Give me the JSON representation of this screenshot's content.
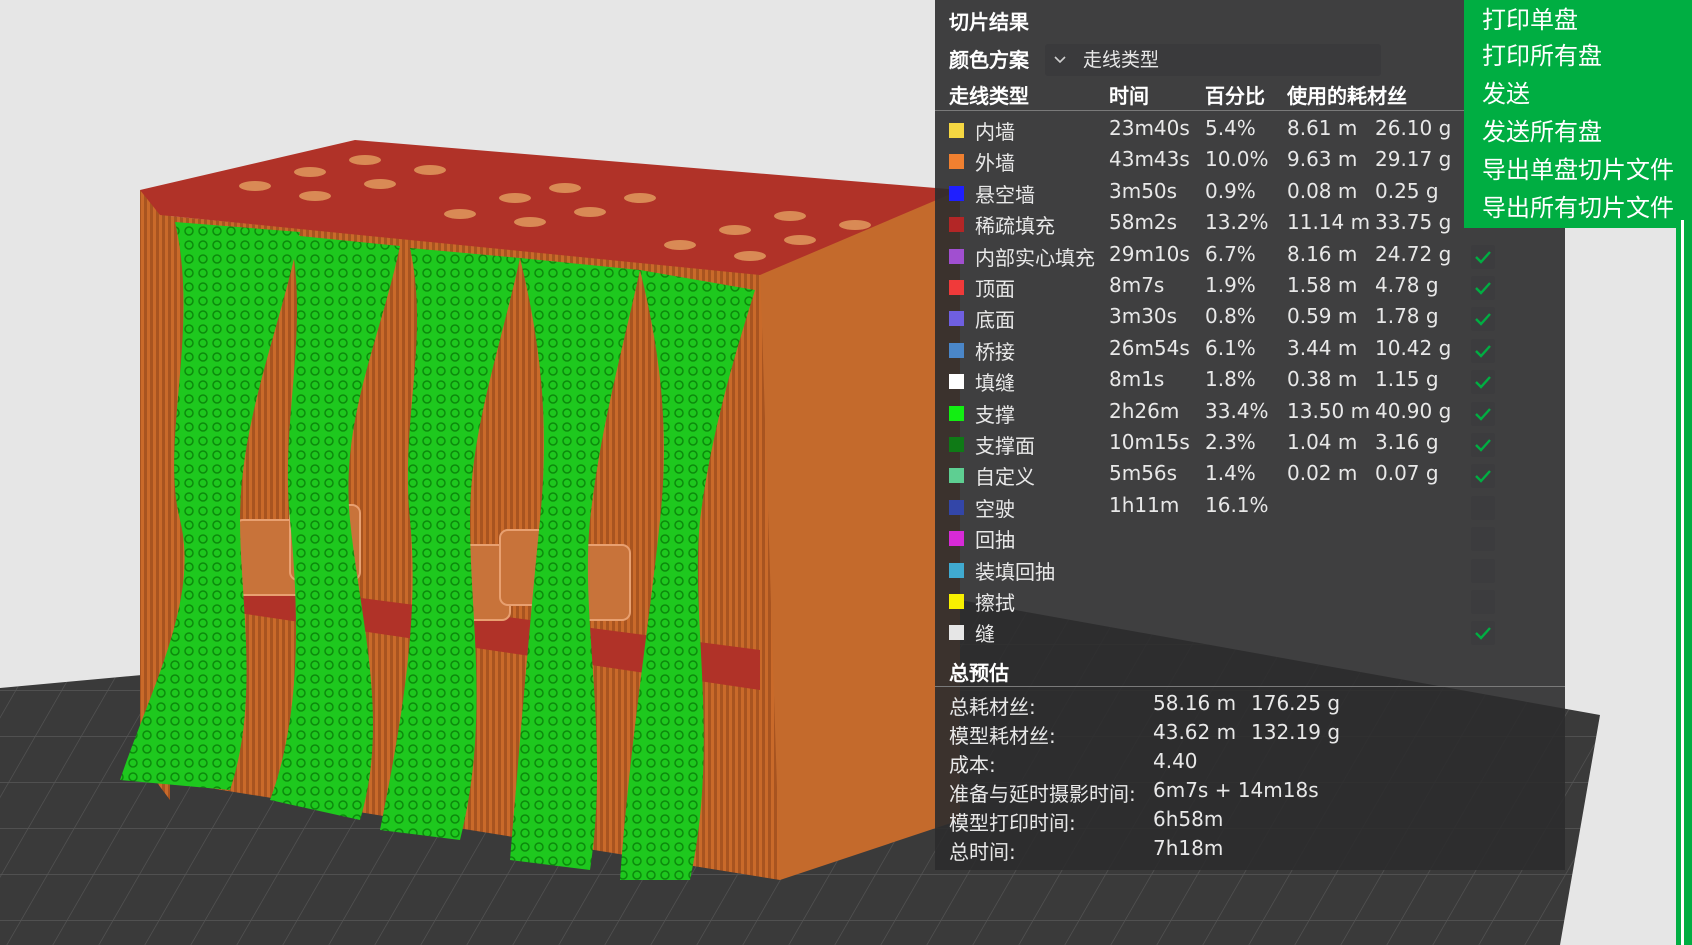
{
  "panel": {
    "title": "切片结果",
    "color_scheme_label": "颜色方案",
    "color_scheme_value": "走线类型",
    "columns": [
      "走线类型",
      "时间",
      "百分比",
      "使用的耗材丝"
    ],
    "rows": [
      {
        "name": "内墙",
        "color": "#f5d742",
        "time": "23m40s",
        "percent": "5.4%",
        "length": "8.61 m",
        "weight": "26.10 g",
        "visible": true
      },
      {
        "name": "外墙",
        "color": "#f08030",
        "time": "43m43s",
        "percent": "10.0%",
        "length": "9.63 m",
        "weight": "29.17 g",
        "visible": true
      },
      {
        "name": "悬空墙",
        "color": "#1f1fff",
        "time": "3m50s",
        "percent": "0.9%",
        "length": "0.08 m",
        "weight": "0.25 g",
        "visible": true
      },
      {
        "name": "稀疏填充",
        "color": "#b32626",
        "time": "58m2s",
        "percent": "13.2%",
        "length": "11.14 m",
        "weight": "33.75 g",
        "visible": true
      },
      {
        "name": "内部实心填充",
        "color": "#a14fd0",
        "time": "29m10s",
        "percent": "6.7%",
        "length": "8.16 m",
        "weight": "24.72 g",
        "visible": true
      },
      {
        "name": "顶面",
        "color": "#f03a3a",
        "time": "8m7s",
        "percent": "1.9%",
        "length": "1.58 m",
        "weight": "4.78 g",
        "visible": true
      },
      {
        "name": "底面",
        "color": "#6f5fe0",
        "time": "3m30s",
        "percent": "0.8%",
        "length": "0.59 m",
        "weight": "1.78 g",
        "visible": true
      },
      {
        "name": "桥接",
        "color": "#4a86c8",
        "time": "26m54s",
        "percent": "6.1%",
        "length": "3.44 m",
        "weight": "10.42 g",
        "visible": true
      },
      {
        "name": "填缝",
        "color": "#ffffff",
        "time": "8m1s",
        "percent": "1.8%",
        "length": "0.38 m",
        "weight": "1.15 g",
        "visible": true
      },
      {
        "name": "支撑",
        "color": "#12ee12",
        "time": "2h26m",
        "percent": "33.4%",
        "length": "13.50 m",
        "weight": "40.90 g",
        "visible": true
      },
      {
        "name": "支撑面",
        "color": "#0f7a16",
        "time": "10m15s",
        "percent": "2.3%",
        "length": "1.04 m",
        "weight": "3.16 g",
        "visible": true
      },
      {
        "name": "自定义",
        "color": "#5ecf92",
        "time": "5m56s",
        "percent": "1.4%",
        "length": "0.02 m",
        "weight": "0.07 g",
        "visible": true
      },
      {
        "name": "空驶",
        "color": "#3346a8",
        "time": "1h11m",
        "percent": "16.1%",
        "length": "",
        "weight": "",
        "visible": false
      },
      {
        "name": "回抽",
        "color": "#d72ad7",
        "time": "",
        "percent": "",
        "length": "",
        "weight": "",
        "visible": false
      },
      {
        "name": "装填回抽",
        "color": "#40aad0",
        "time": "",
        "percent": "",
        "length": "",
        "weight": "",
        "visible": false
      },
      {
        "name": "擦拭",
        "color": "#f8f000",
        "time": "",
        "percent": "",
        "length": "",
        "weight": "",
        "visible": false
      },
      {
        "name": "缝",
        "color": "#e6e6e6",
        "time": "",
        "percent": "",
        "length": "",
        "weight": "",
        "visible": true
      }
    ],
    "summary_title": "总预估",
    "summary": [
      {
        "label": "总耗材丝:",
        "value": "58.16 m",
        "value2": "176.25 g"
      },
      {
        "label": "模型耗材丝:",
        "value": "43.62 m",
        "value2": "132.19 g"
      },
      {
        "label": "成本:",
        "value": "4.40",
        "value2": ""
      },
      {
        "label": "准备与延时摄影时间:",
        "value": "6m7s + 14m18s",
        "value2": ""
      },
      {
        "label": "模型打印时间:",
        "value": "6h58m",
        "value2": ""
      },
      {
        "label": "总时间:",
        "value": "7h18m",
        "value2": ""
      }
    ]
  },
  "menu": {
    "items": [
      "打印单盘",
      "打印所有盘",
      "发送",
      "发送所有盘",
      "导出单盘切片文件",
      "导出所有切片文件"
    ],
    "color": "#00ae42"
  },
  "icons": {
    "dropdown": "chevron-down-icon",
    "check": "checkmark-icon"
  }
}
